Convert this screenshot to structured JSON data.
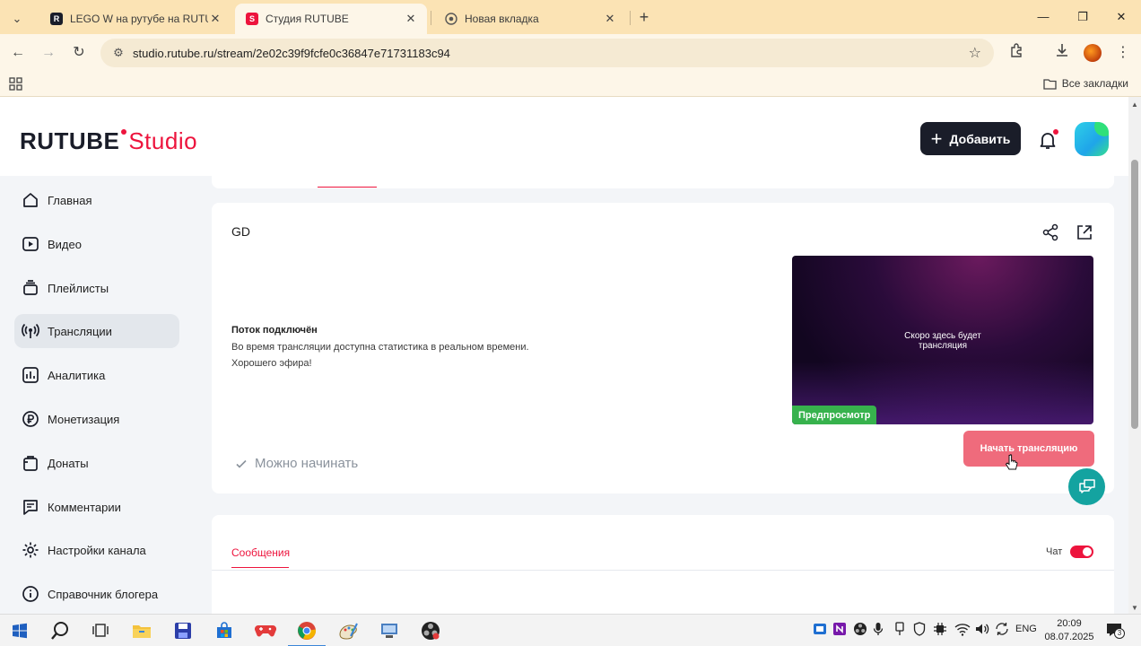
{
  "browser": {
    "tabs": [
      {
        "title": "LEGO W на рутубе на RUTUBE",
        "favicon": "R"
      },
      {
        "title": "Студия RUTUBE",
        "favicon": "S"
      },
      {
        "title": "Новая вкладка",
        "favicon": ""
      }
    ],
    "url": "studio.rutube.ru/stream/2e02c39f9fcfe0c36847e71731183c94",
    "all_bookmarks": "Все закладки"
  },
  "header": {
    "logo_main": "RUTUBE",
    "logo_studio": "Studio",
    "add_label": "Добавить"
  },
  "sidebar": {
    "items": [
      {
        "label": "Главная",
        "icon": "home-icon"
      },
      {
        "label": "Видео",
        "icon": "video-icon"
      },
      {
        "label": "Плейлисты",
        "icon": "playlist-icon"
      },
      {
        "label": "Трансляции",
        "icon": "broadcast-icon",
        "active": true
      },
      {
        "label": "Аналитика",
        "icon": "analytics-icon"
      },
      {
        "label": "Монетизация",
        "icon": "ruble-icon"
      },
      {
        "label": "Донаты",
        "icon": "donate-icon"
      },
      {
        "label": "Комментарии",
        "icon": "comment-icon"
      },
      {
        "label": "Настройки канала",
        "icon": "gear-icon"
      },
      {
        "label": "Справочник блогера",
        "icon": "info-icon"
      }
    ]
  },
  "stream": {
    "title": "GD",
    "status_title": "Поток подключён",
    "status_line1": "Во время трансляции доступна статистика в реальном времени.",
    "status_line2": "Хорошего эфира!",
    "preview_text_line1": "Скоро здесь будет",
    "preview_text_line2": "трансляция",
    "preview_badge": "Предпросмотр",
    "ready_text": "Можно начинать",
    "start_label": "Начать трансляцию"
  },
  "chat_panel": {
    "messages_tab": "Сообщения",
    "chat_label": "Чат",
    "chat_enabled": true
  },
  "taskbar": {
    "lang": "ENG",
    "time": "20:09",
    "date": "08.07.2025",
    "notif_count": "3"
  },
  "colors": {
    "brand_red": "#ed143d",
    "start_button": "#ef6b7c",
    "preview_badge": "#37b24d",
    "help_fab": "#14a3a0"
  }
}
